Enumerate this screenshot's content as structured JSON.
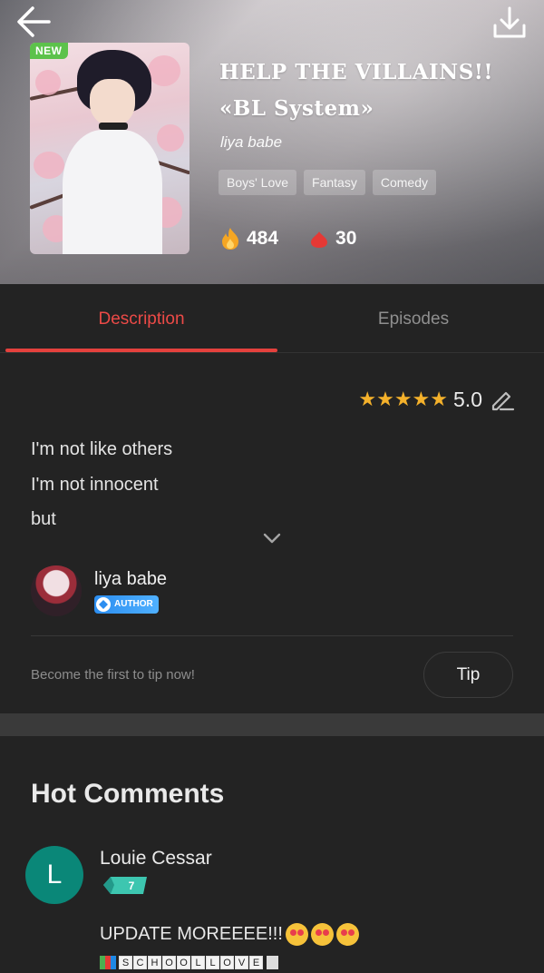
{
  "header": {
    "new_badge": "NEW",
    "title": "HELP THE VILLAINS!! «BL System»",
    "author": "liya babe",
    "tags": [
      "Boys' Love",
      "Fantasy",
      "Comedy"
    ],
    "views": "484",
    "likes": "30"
  },
  "tabs": {
    "description": "Description",
    "episodes": "Episodes"
  },
  "rating": {
    "stars": 5,
    "value": "5.0"
  },
  "description": {
    "lines": [
      "I'm not like others",
      "I'm not innocent",
      "but"
    ]
  },
  "author_card": {
    "name": "liya babe",
    "badge": "AUTHOR"
  },
  "tip": {
    "prompt": "Become the first to tip now!",
    "button": "Tip"
  },
  "comments": {
    "section_title": "Hot Comments",
    "items": [
      {
        "avatar_letter": "L",
        "user": "Louie Cessar",
        "level": "7",
        "text": "UPDATE MOREEEE!!!",
        "signature_letters": [
          "S",
          "C",
          "H",
          "O",
          "O",
          "L",
          "L",
          "O",
          "V",
          "E"
        ]
      }
    ]
  },
  "colors": {
    "accent": "#ec4a47",
    "star": "#f4b12b",
    "avatar_bg": "#0a8778",
    "author_badge": "#2c8ef0"
  },
  "icons": [
    "back-arrow-icon",
    "download-icon",
    "fire-icon",
    "heart-icon",
    "star-icon",
    "pencil-icon",
    "chevron-down-icon",
    "diamond-icon"
  ]
}
